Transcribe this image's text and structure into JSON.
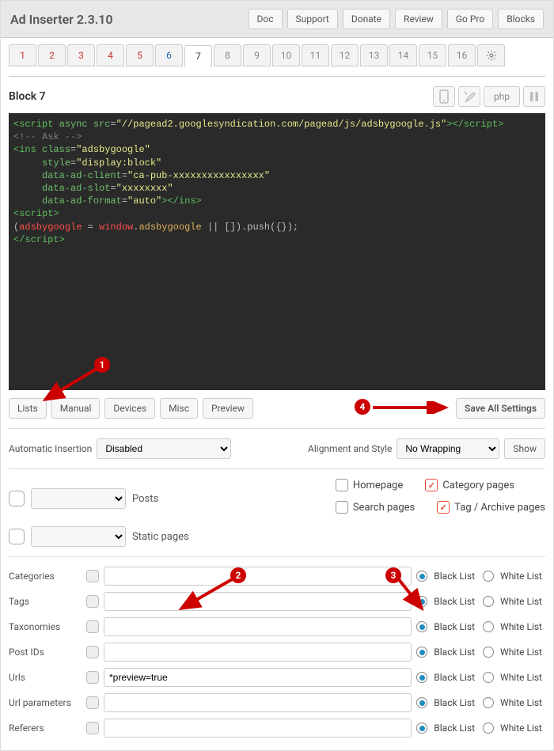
{
  "header": {
    "title": "Ad Inserter 2.3.10",
    "buttons": [
      "Doc",
      "Support",
      "Donate",
      "Review",
      "Go Pro",
      "Blocks"
    ]
  },
  "tabs": {
    "items": [
      "1",
      "2",
      "3",
      "4",
      "5",
      "6",
      "7",
      "8",
      "9",
      "10",
      "11",
      "12",
      "13",
      "14",
      "15",
      "16"
    ],
    "active_index": 6
  },
  "block": {
    "name": "Block 7",
    "php_label": "php"
  },
  "code_lines": [
    [
      [
        "tag",
        "<script"
      ],
      [
        "attr",
        " async"
      ],
      [
        "attr",
        " src"
      ],
      [
        "punc",
        "="
      ],
      [
        "str",
        "\"//pagead2.googlesyndication.com/pagead/js/adsbygoogle.js\""
      ],
      [
        "tag",
        ">"
      ],
      [
        "tag",
        "</script"
      ],
      [
        "tag",
        ">"
      ]
    ],
    [
      [
        "cmt",
        "<!-- Ask -->"
      ]
    ],
    [
      [
        "tag",
        "<ins"
      ],
      [
        "attr",
        " class"
      ],
      [
        "punc",
        "="
      ],
      [
        "str",
        "\"adsbygoogle\""
      ]
    ],
    [
      [
        "plain",
        "     "
      ],
      [
        "attr",
        "style"
      ],
      [
        "punc",
        "="
      ],
      [
        "str",
        "\"display:block\""
      ]
    ],
    [
      [
        "plain",
        "     "
      ],
      [
        "attr",
        "data-ad-client"
      ],
      [
        "punc",
        "="
      ],
      [
        "str",
        "\"ca-pub-xxxxxxxxxxxxxxxx\""
      ]
    ],
    [
      [
        "plain",
        "     "
      ],
      [
        "attr",
        "data-ad-slot"
      ],
      [
        "punc",
        "="
      ],
      [
        "str",
        "\"xxxxxxxx\""
      ]
    ],
    [
      [
        "plain",
        "     "
      ],
      [
        "attr",
        "data-ad-format"
      ],
      [
        "punc",
        "="
      ],
      [
        "str",
        "\"auto\""
      ],
      [
        "tag",
        ">"
      ],
      [
        "tag",
        "</ins"
      ],
      [
        "tag",
        ">"
      ]
    ],
    [
      [
        "tag",
        "<script"
      ],
      [
        "tag",
        ">"
      ]
    ],
    [
      [
        "punc",
        "("
      ],
      [
        "glob",
        "adsbygoogle"
      ],
      [
        "punc",
        " = "
      ],
      [
        "glob",
        "window"
      ],
      [
        "punc",
        "."
      ],
      [
        "orange",
        "adsbygoogle"
      ],
      [
        "punc",
        " || []).push({});"
      ]
    ],
    [
      [
        "tag",
        "</script"
      ],
      [
        "tag",
        ">"
      ]
    ]
  ],
  "toolbar2": {
    "buttons": [
      "Lists",
      "Manual",
      "Devices",
      "Misc",
      "Preview"
    ],
    "save_label": "Save All Settings"
  },
  "insertion": {
    "auto_label": "Automatic Insertion",
    "auto_value": "Disabled",
    "align_label": "Alignment and Style",
    "align_value": "No Wrapping",
    "show_label": "Show"
  },
  "page_types": {
    "posts": "Posts",
    "static": "Static pages",
    "homepage": "Homepage",
    "search": "Search pages",
    "category": "Category pages",
    "tag": "Tag / Archive pages",
    "category_checked": true,
    "tag_checked": true
  },
  "lists": {
    "black": "Black List",
    "white": "White List",
    "rows": [
      {
        "label": "Categories",
        "value": "",
        "black": true
      },
      {
        "label": "Tags",
        "value": "",
        "black": true
      },
      {
        "label": "Taxonomies",
        "value": "",
        "black": true
      },
      {
        "label": "Post IDs",
        "value": "",
        "black": true
      },
      {
        "label": "Urls",
        "value": "*preview=true",
        "black": true
      },
      {
        "label": "Url parameters",
        "value": "",
        "black": true
      },
      {
        "label": "Referers",
        "value": "",
        "black": true
      }
    ]
  },
  "annotations": {
    "b1": "1",
    "b2": "2",
    "b3": "3",
    "b4": "4"
  }
}
